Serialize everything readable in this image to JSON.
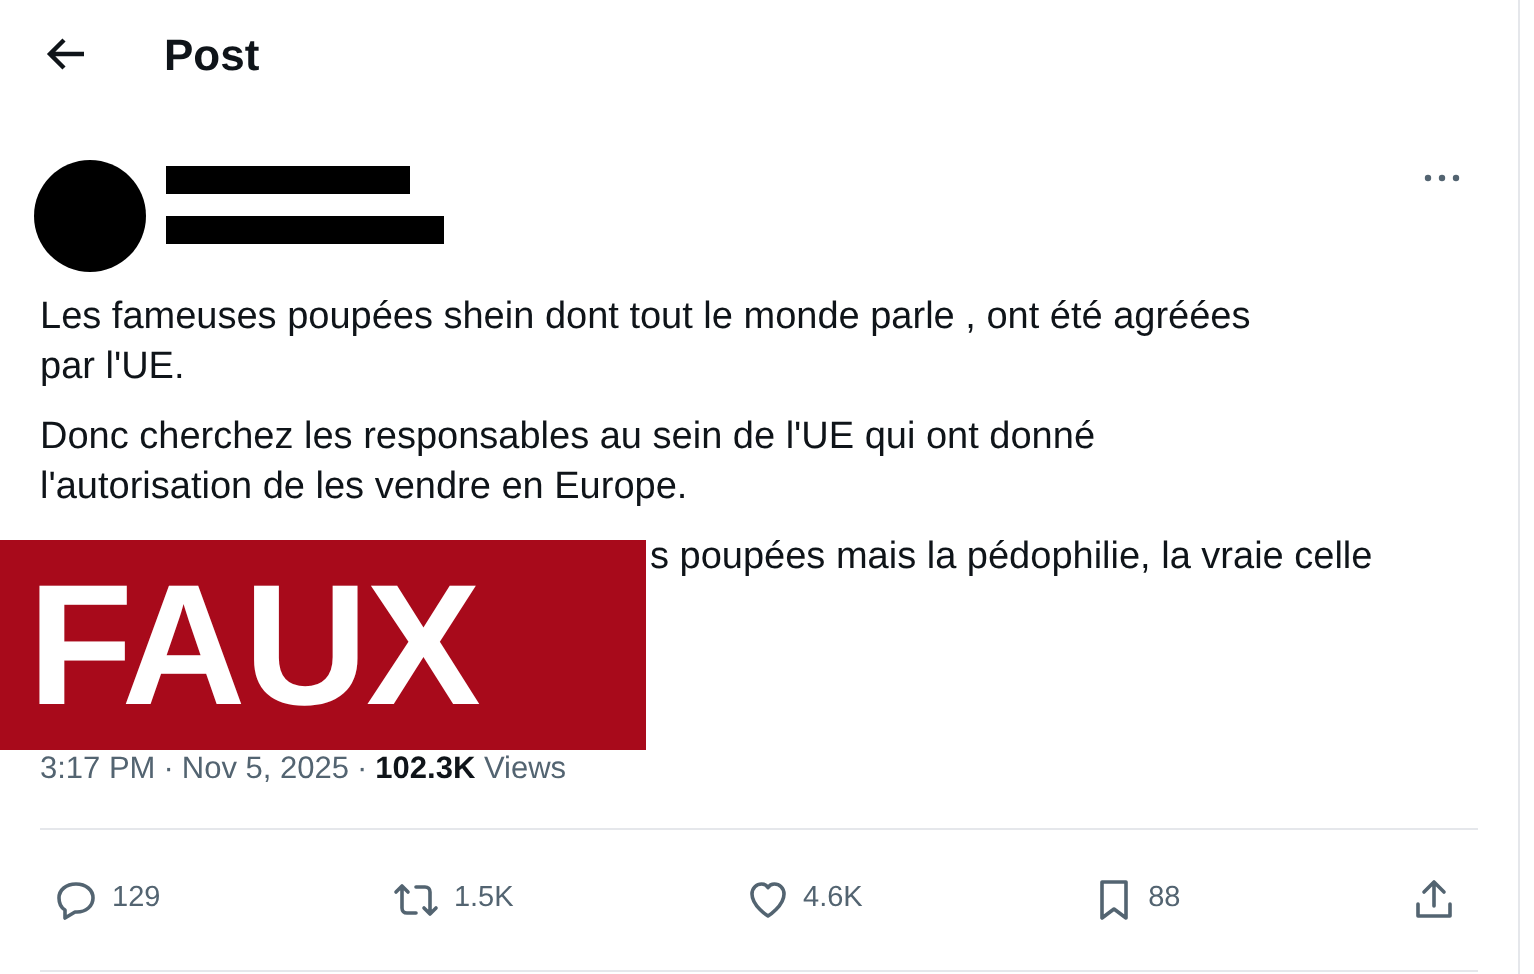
{
  "header": {
    "title": "Post"
  },
  "post": {
    "author": {
      "redacted": true
    },
    "paragraphs": [
      {
        "lines": [
          "Les fameuses poupées shein dont tout le monde parle , ont été agréées",
          "par l'UE."
        ]
      },
      {
        "lines": [
          "Donc cherchez les responsables au sein de l'UE qui ont donné",
          "l'autorisation de les vendre en Europe."
        ]
      }
    ],
    "cut_line": "s poupées mais la pédophilie, la vraie celle",
    "time": "3:17 PM",
    "separator_1": "·",
    "date": "Nov 5, 2025",
    "separator_2": "·",
    "views_count": "102.3K",
    "views_label": "Views",
    "actions": [
      {
        "kind": "reply",
        "count": "129"
      },
      {
        "kind": "repost",
        "count": "1.5K"
      },
      {
        "kind": "like",
        "count": "4.6K"
      },
      {
        "kind": "bookmark",
        "count": "88"
      },
      {
        "kind": "share"
      }
    ]
  },
  "stamp": {
    "text": "FAUX"
  }
}
